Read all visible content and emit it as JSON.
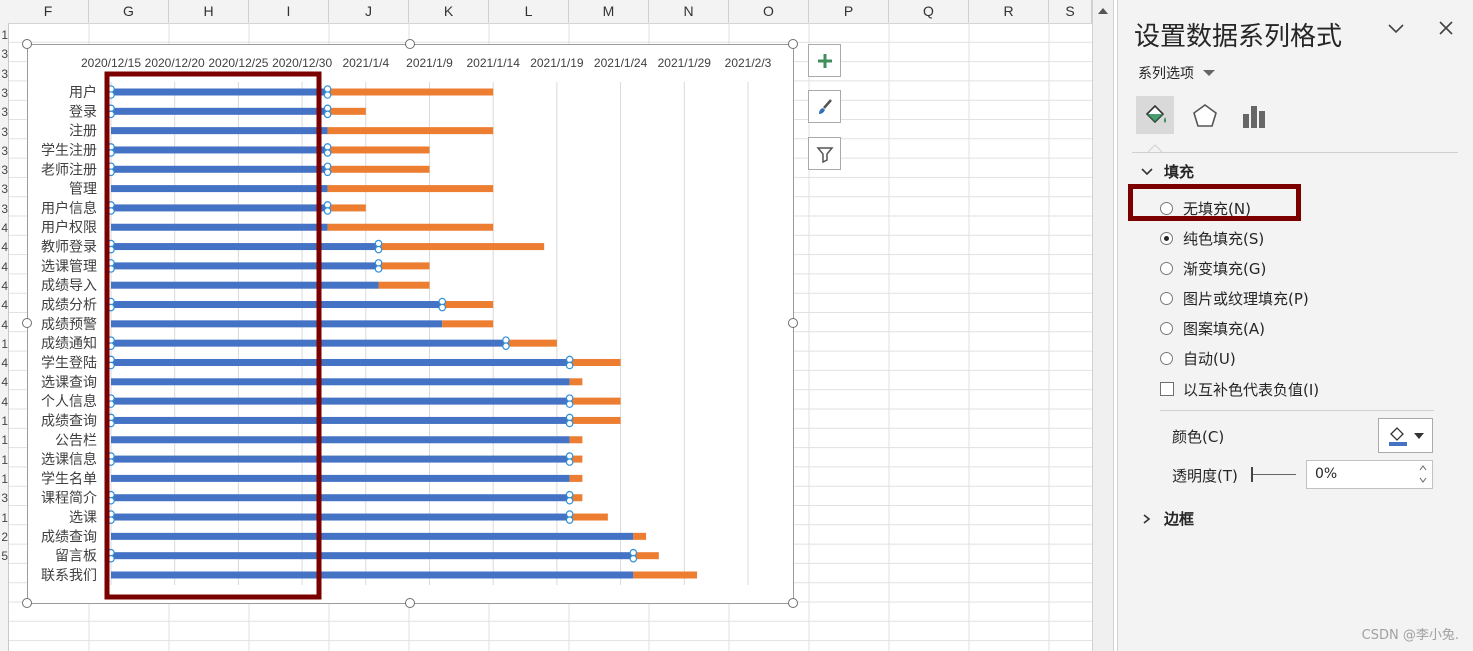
{
  "columns": [
    "F",
    "G",
    "H",
    "I",
    "J",
    "K",
    "L",
    "M",
    "N",
    "O",
    "P",
    "Q",
    "R",
    "S"
  ],
  "row_numbers": [
    "1",
    "3",
    "3",
    "3",
    "3",
    "3",
    "3",
    "3",
    "3",
    "3",
    "4",
    "4",
    "4",
    "4",
    "4",
    "4",
    "1",
    "4",
    "4",
    "4",
    "1",
    "1",
    "1",
    "1",
    "3",
    "1",
    "2",
    "5"
  ],
  "chart": {
    "dates": [
      "2020/12/15",
      "2020/12/20",
      "2020/12/25",
      "2020/12/30",
      "2021/1/4",
      "2021/1/9",
      "2021/1/14",
      "2021/1/19",
      "2021/1/24",
      "2021/1/29",
      "2021/2/3"
    ],
    "start_date": "2020/12/15",
    "tasks": [
      {
        "label": "用户",
        "start": 0,
        "duration": 17,
        "extra": 13
      },
      {
        "label": "登录",
        "start": 0,
        "duration": 17,
        "extra": 3
      },
      {
        "label": "注册",
        "start": 0,
        "duration": 17,
        "extra": 13
      },
      {
        "label": "学生注册",
        "start": 0,
        "duration": 17,
        "extra": 8
      },
      {
        "label": "老师注册",
        "start": 0,
        "duration": 17,
        "extra": 8
      },
      {
        "label": "管理",
        "start": 0,
        "duration": 17,
        "extra": 13
      },
      {
        "label": "用户信息",
        "start": 0,
        "duration": 17,
        "extra": 3
      },
      {
        "label": "用户权限",
        "start": 0,
        "duration": 17,
        "extra": 13
      },
      {
        "label": "教师登录",
        "start": 0,
        "duration": 21,
        "extra": 13
      },
      {
        "label": "选课管理",
        "start": 0,
        "duration": 21,
        "extra": 4
      },
      {
        "label": "成绩导入",
        "start": 0,
        "duration": 21,
        "extra": 4
      },
      {
        "label": "成绩分析",
        "start": 0,
        "duration": 26,
        "extra": 4
      },
      {
        "label": "成绩预警",
        "start": 0,
        "duration": 26,
        "extra": 4
      },
      {
        "label": "成绩通知",
        "start": 0,
        "duration": 31,
        "extra": 4
      },
      {
        "label": "学生登陆",
        "start": 0,
        "duration": 36,
        "extra": 4
      },
      {
        "label": "选课查询",
        "start": 0,
        "duration": 36,
        "extra": 1
      },
      {
        "label": "个人信息",
        "start": 0,
        "duration": 36,
        "extra": 4
      },
      {
        "label": "成绩查询",
        "start": 0,
        "duration": 36,
        "extra": 4
      },
      {
        "label": "公告栏",
        "start": 0,
        "duration": 36,
        "extra": 1
      },
      {
        "label": "选课信息",
        "start": 0,
        "duration": 36,
        "extra": 1
      },
      {
        "label": "学生名单",
        "start": 0,
        "duration": 36,
        "extra": 1
      },
      {
        "label": "课程简介",
        "start": 0,
        "duration": 36,
        "extra": 1
      },
      {
        "label": "选课",
        "start": 0,
        "duration": 36,
        "extra": 3
      },
      {
        "label": "成绩查询",
        "start": 0,
        "duration": 41,
        "extra": 1
      },
      {
        "label": "留言板",
        "start": 0,
        "duration": 41,
        "extra": 2
      },
      {
        "label": "联系我们",
        "start": 0,
        "duration": 41,
        "extra": 5
      }
    ],
    "selected_series_markers": [
      0,
      1,
      3,
      4,
      6,
      8,
      9,
      11,
      13,
      14,
      16,
      17,
      19,
      21,
      22,
      24
    ],
    "colors": {
      "start_series": "#4472c4",
      "extra_series": "#ed7d31",
      "highlight_box": "#7b0000"
    }
  },
  "panel": {
    "title": "设置数据系列格式",
    "series_options": "系列选项",
    "fill_section": "填充",
    "border_section": "边框",
    "fill_options": [
      {
        "label": "无填充(N)",
        "checked": false
      },
      {
        "label": "纯色填充(S)",
        "checked": true
      },
      {
        "label": "渐变填充(G)",
        "checked": false
      },
      {
        "label": "图片或纹理填充(P)",
        "checked": false
      },
      {
        "label": "图案填充(A)",
        "checked": false
      },
      {
        "label": "自动(U)",
        "checked": false
      }
    ],
    "invert_label": "以互补色代表负值(I)",
    "color_label": "颜色(C)",
    "transparency_label": "透明度(T)",
    "transparency_value": "0%",
    "watermark": "CSDN @李小兔."
  }
}
